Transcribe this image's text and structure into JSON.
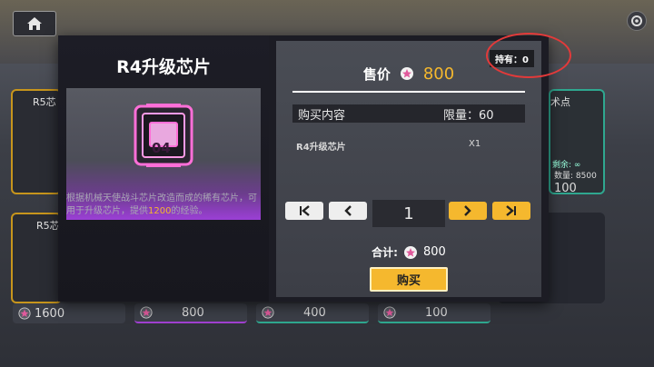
{
  "background": {
    "prices": [
      "1600",
      "800",
      "400",
      "100",
      "100"
    ],
    "card_labels": [
      "R5芯",
      "R5芯",
      "术点"
    ],
    "remaining": "剩余: ∞",
    "quantity": "数量: 8500"
  },
  "item": {
    "title": "R4升级芯片",
    "chip_label": "04",
    "desc_prefix": "根据机械天使战斗芯片改造而成的稀有芯片，可用于升级芯片，提供",
    "desc_highlight": "1200",
    "desc_suffix": "的经验。"
  },
  "purchase": {
    "held": "持有：0",
    "price_label": "售价",
    "price_value": "800",
    "contents_header": "购买内容",
    "limit_label": "限量：60",
    "content_name": "R4升级芯片",
    "content_qty": "X1",
    "quantity": "1",
    "total_label": "合计:",
    "total_value": "800",
    "buy_label": "购买"
  },
  "colors": {
    "accent": "#f5b82e",
    "gem": "#e05a9c",
    "annotation": "#e23a3a"
  },
  "icons": [
    "home-icon",
    "gear-icon",
    "gem-icon",
    "first-page-icon",
    "prev-page-icon",
    "next-page-icon",
    "last-page-icon"
  ]
}
